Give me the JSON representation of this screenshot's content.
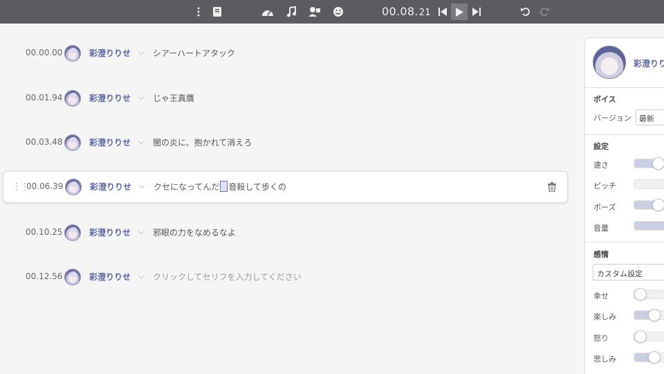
{
  "toolbar": {
    "time_main": "00.08.",
    "time_frac": "21"
  },
  "script": {
    "lines": [
      {
        "time": "00.00.00",
        "speaker": "彩澄りりせ",
        "text": "シアーハートアタック"
      },
      {
        "time": "00.01.94",
        "speaker": "彩澄りりせ",
        "text": "じゃ王真贋"
      },
      {
        "time": "00.03.48",
        "speaker": "彩澄りりせ",
        "text": "闇の炎に、抱かれて消えろ"
      },
      {
        "time": "00.06.39",
        "speaker": "彩澄りりせ",
        "text_before": "クセになってんだ",
        "text_mid": "、",
        "text_after": "音殺して歩くの"
      },
      {
        "time": "00.10.25",
        "speaker": "彩澄りりせ",
        "text": "邪眼の力をなめるなよ"
      },
      {
        "time": "00.12.56",
        "speaker": "彩澄りりせ",
        "placeholder": "クリックしてセリフを入力してください"
      }
    ]
  },
  "panel": {
    "name": "彩澄りり",
    "voice_section": "ボイス",
    "version_label": "バージョン",
    "version_value": "最新",
    "settings_section": "設定",
    "speed_label": "速さ",
    "pitch_label": "ピッチ",
    "pause_label": "ポーズ",
    "volume_label": "音量",
    "emotion_section": "感情",
    "emotion_preset": "カスタム設定",
    "happy_label": "幸せ",
    "fun_label": "楽しみ",
    "anger_label": "怒り",
    "sad_label": "悲しみ",
    "sliders": {
      "speed": 0.6,
      "pitch": 0.0,
      "pause": 0.6,
      "volume": 0.75,
      "happy": 0.0,
      "fun": 0.5,
      "anger": 0.0,
      "sad": 0.5
    }
  },
  "colors": {
    "toolbar_bg": "#5c5c60",
    "accent": "#5a63a6",
    "slider_fill": "#cacfe3"
  }
}
